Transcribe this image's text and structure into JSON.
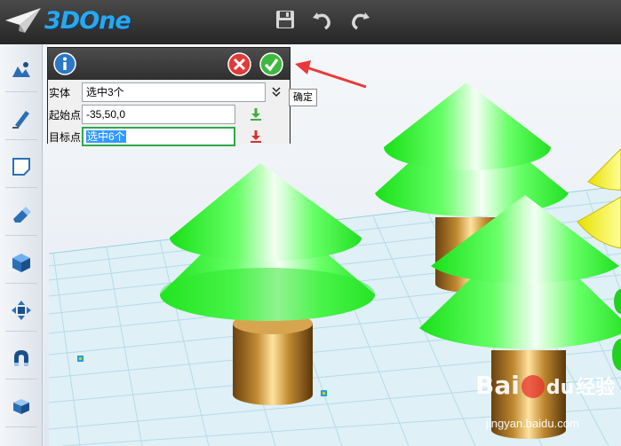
{
  "app": {
    "logo_text": "3DOne"
  },
  "toolbar": {
    "save_icon": "save-icon",
    "undo_icon": "undo-icon",
    "redo_icon": "redo-icon"
  },
  "left_tools": [
    "sketch-tool-icon",
    "pen-tool-icon",
    "note-tool-icon",
    "eraser-tool-icon",
    "cube-tool-icon",
    "move-tool-icon",
    "magnet-tool-icon",
    "box-tool-icon"
  ],
  "panel": {
    "info_icon": "info-icon",
    "cancel_icon": "cancel-icon",
    "confirm_icon": "confirm-icon",
    "rows": [
      {
        "label": "实体",
        "value": "选中3个"
      },
      {
        "label": "起始点",
        "value": "-35,50,0"
      },
      {
        "label": "目标点",
        "value": "选中6个"
      }
    ],
    "confirm_tooltip": "确定"
  },
  "watermark": {
    "brand": "Bai",
    "paw": "du",
    "cn": "经验",
    "url": "jingyan.baidu.com"
  },
  "colors": {
    "accent": "#2aa7ee",
    "tree_green": "#22ff22",
    "trunk": "#b07a20",
    "arrow": "#e83a3a"
  }
}
